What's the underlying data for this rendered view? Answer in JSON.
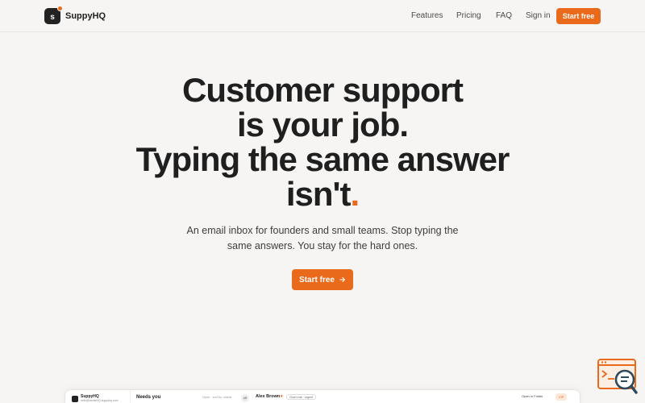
{
  "header": {
    "logo_letter": "s",
    "brand": "SuppyHQ",
    "nav": [
      {
        "label": "Features"
      },
      {
        "label": "Pricing"
      },
      {
        "label": "FAQ"
      },
      {
        "label": "Sign in"
      }
    ],
    "cta_label": "Start free"
  },
  "hero": {
    "title_lines": [
      "Customer support",
      "is your job.",
      "Typing the same answer",
      "isn't"
    ],
    "title_accent": ".",
    "subtitle_line1": "An email inbox for founders and small teams. Stop typing the",
    "subtitle_line2": "same answers. You stay for the hard ones.",
    "cta_label": "Start free",
    "cta_icon": "arrow-right-icon"
  },
  "preview": {
    "brand": "SuppyHQ",
    "email": "hello@acmeHQ.suppyhq.com",
    "section_title": "Needs you",
    "filter_text": "Open · sort by: oldest",
    "avatar_initials": "AB",
    "customer_name": "Alex Brown",
    "tag": "Churn risk · urgent",
    "open_action": "Open in Folder",
    "vip_badge": "VIP"
  },
  "colors": {
    "accent": "#ea6a1c",
    "background": "#f6f5f3",
    "text": "#1f1f1f"
  },
  "widget": {
    "icon": "help-chat-icon"
  }
}
